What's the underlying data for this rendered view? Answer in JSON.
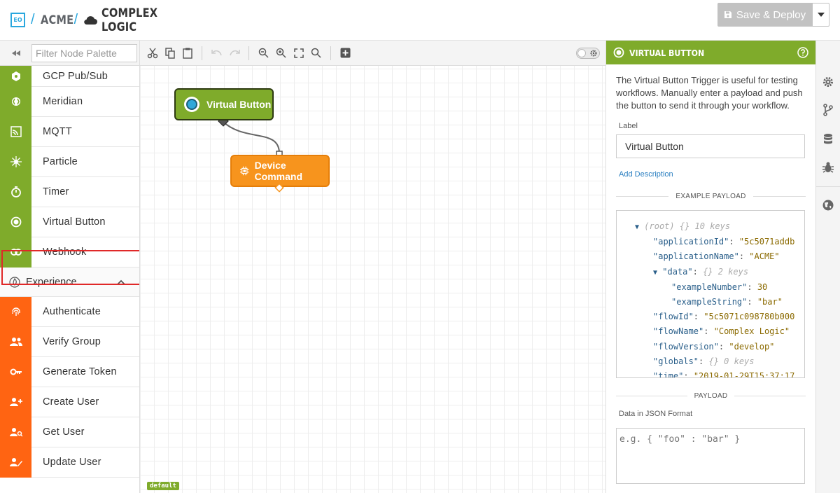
{
  "header": {
    "logo": "EO",
    "separator": "/",
    "app_name": "ACME",
    "flow_name": "COMPLEX LOGIC",
    "deploy_label": "Save & Deploy"
  },
  "palette": {
    "filter_placeholder": "Filter Node Palette",
    "trigger_nodes": [
      {
        "label": "GCP Pub/Sub",
        "icon": "hexagon-icon"
      },
      {
        "label": "Meridian",
        "icon": "meridian-icon"
      },
      {
        "label": "MQTT",
        "icon": "mqtt-icon"
      },
      {
        "label": "Particle",
        "icon": "particle-icon"
      },
      {
        "label": "Timer",
        "icon": "stopwatch-icon"
      },
      {
        "label": "Virtual Button",
        "icon": "radio-button-icon"
      },
      {
        "label": "Webhook",
        "icon": "link-icon"
      }
    ],
    "section": {
      "label": "Experience"
    },
    "experience_nodes": [
      {
        "label": "Authenticate",
        "icon": "fingerprint-icon"
      },
      {
        "label": "Verify Group",
        "icon": "users-icon"
      },
      {
        "label": "Generate Token",
        "icon": "key-icon"
      },
      {
        "label": "Create User",
        "icon": "user-plus-icon"
      },
      {
        "label": "Get User",
        "icon": "user-search-icon"
      },
      {
        "label": "Update User",
        "icon": "user-edit-icon"
      }
    ]
  },
  "canvas": {
    "nodes": {
      "virtual_button": "Virtual Button",
      "device_command": "Device Command"
    },
    "tag": "default"
  },
  "panel": {
    "title": "VIRTUAL BUTTON",
    "description": "The Virtual Button Trigger is useful for testing workflows. Manually enter a payload and push the button to send it through your workflow.",
    "label_caption": "Label",
    "label_value": "Virtual Button",
    "add_description": "Add Description",
    "example_payload_heading": "EXAMPLE PAYLOAD",
    "json": {
      "root": "(root)",
      "root_meta": "{}  10 keys",
      "applicationId_key": "\"applicationId\"",
      "applicationId_val": "\"5c5071addb",
      "applicationName_key": "\"applicationName\"",
      "applicationName_val": "\"ACME\"",
      "data_key": "\"data\"",
      "data_meta": "{}  2 keys",
      "exampleNumber_key": "\"exampleNumber\"",
      "exampleNumber_val": "30",
      "exampleString_key": "\"exampleString\"",
      "exampleString_val": "\"bar\"",
      "flowId_key": "\"flowId\"",
      "flowId_val": "\"5c5071c098780b000",
      "flowName_key": "\"flowName\"",
      "flowName_val": "\"Complex Logic\"",
      "flowVersion_key": "\"flowVersion\"",
      "flowVersion_val": "\"develop\"",
      "globals_key": "\"globals\"",
      "globals_meta": "{}  0 keys",
      "time_key": "\"time\"",
      "time_val": "\"2019-01-29T15:37:17"
    },
    "payload_heading": "PAYLOAD",
    "payload_caption": "Data in JSON Format",
    "payload_placeholder": "e.g. { \"foo\" : \"bar\" }"
  },
  "colors": {
    "trigger_green": "#7fab2b",
    "experience_orange": "#ff6412",
    "device_orange": "#f7941d",
    "highlight_red": "#e02828"
  }
}
